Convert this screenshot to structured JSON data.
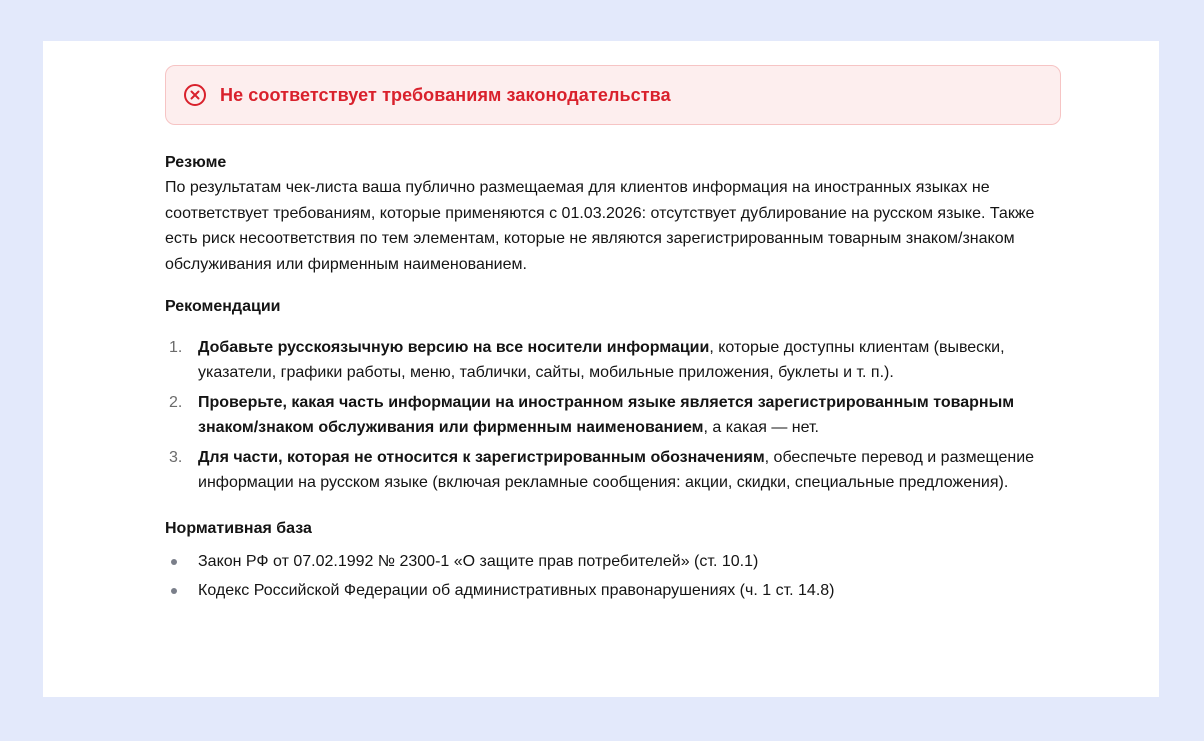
{
  "alert": {
    "icon": "close-circle-icon",
    "text": "Не соответствует требованиям законодательства",
    "color": "#d9212c"
  },
  "summary": {
    "title": "Резюме",
    "text": "По результатам чек-листа ваша публично размещаемая для клиентов информация на иностранных языках не соответствует требованиям, которые применяются с 01.03.2026: отсутствует дублирование на русском языке. Также есть риск несоответствия по тем элементам, которые не являются зарегистрированным товарным знаком/знаком обслуживания или фирменным наименованием."
  },
  "recommendations": {
    "title": "Рекомендации",
    "items": [
      {
        "number": "1.",
        "bold": "Добавьте русскоязычную версию на все носители информации",
        "text": ", которые доступны клиентам (вывески, указатели, графики работы, меню, таблички, сайты, мобильные приложения, буклеты и т. п.)."
      },
      {
        "number": "2.",
        "bold": "Проверьте, какая часть информации на иностранном языке является зарегистрированным товарным знаком/знаком обслуживания или фирменным наименованием",
        "text": ", а какая — нет."
      },
      {
        "number": "3.",
        "bold": "Для части, которая не относится к зарегистрированным обозначениям",
        "text": ", обеспечьте перевод и размещение информации на русском языке (включая рекламные сообщения: акции, скидки, специальные предложения)."
      }
    ]
  },
  "legal_basis": {
    "title": "Нормативная база",
    "items": [
      "Закон РФ от 07.02.1992 № 2300-1 «О защите прав потребителей» (ст. 10.1)",
      "Кодекс Российской Федерации об административных правонарушениях (ч. 1 ст. 14.8)"
    ]
  }
}
